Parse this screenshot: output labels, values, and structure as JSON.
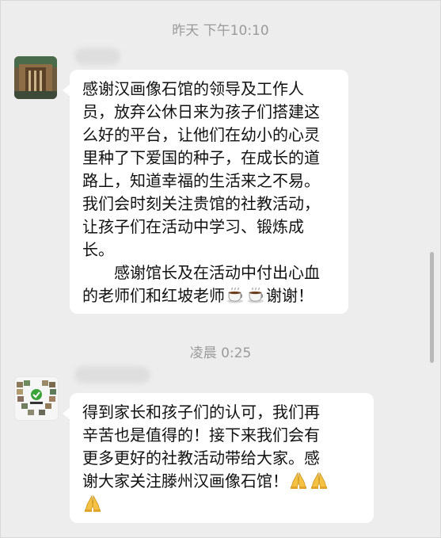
{
  "chat": {
    "timestamp_1": "昨天 下午10:10",
    "timestamp_2": "凌晨 0:25",
    "message_1": {
      "lines": [
        "感谢汉画像石馆的领导及工作人",
        "员，放弃公休日来为孩子们搭建这",
        "么好的平台，让他们在幼小的心灵",
        "里种了下爱国的种子，在成长的道",
        "路上，知道幸福的生活来之不易。",
        "我们会时刻关注贵馆的社教活动，",
        "让孩子们在活动中学习、锻炼成",
        "长。",
        "感谢馆长及在活动中付出心血"
      ],
      "last_line_text": "的老师们和红坡老师",
      "last_line_suffix": "谢谢！",
      "emoji_name": "coffee-emoji"
    },
    "message_2": {
      "lines": [
        "得到家长和孩子们的认可，我们再",
        "辛苦也是值得的！接下来我们会有",
        "更多更好的社教活动带给大家。感",
        "谢大家关注滕州汉画像石馆！"
      ],
      "emoji_name": "folded-hands-emoji"
    }
  }
}
